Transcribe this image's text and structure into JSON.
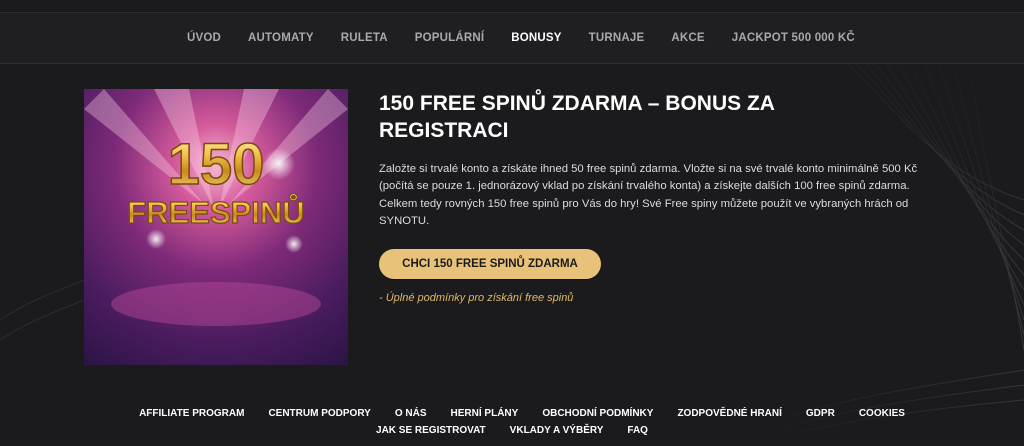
{
  "nav": {
    "items": [
      {
        "label": "ÚVOD",
        "active": false
      },
      {
        "label": "AUTOMATY",
        "active": false
      },
      {
        "label": "RULETA",
        "active": false
      },
      {
        "label": "POPULÁRNÍ",
        "active": false
      },
      {
        "label": "BONUSY",
        "active": true
      },
      {
        "label": "TURNAJE",
        "active": false
      },
      {
        "label": "AKCE",
        "active": false
      },
      {
        "label": "JACKPOT 500 000 KČ",
        "active": false
      }
    ]
  },
  "promo": {
    "image_number": "150",
    "image_word": "FREESPINŮ",
    "title": "150 FREE SPINŮ ZDARMA – BONUS ZA REGISTRACI",
    "description": "Založte si trvalé konto a získáte ihned 50 free spinů zdarma. Vložte si na své trvalé konto minimálně 500 Kč (počítá se pouze 1. jednorázový vklad po získání trvalého konta) a získejte dalších 100 free spinů zdarma. Celkem tedy rovných 150 free spinů pro Vás do hry! Své Free spiny můžete použít ve vybraných hrách od SYNOTU.",
    "cta_label": "CHCI 150 FREE SPINŮ ZDARMA",
    "terms_label": "- Úplné podmínky pro získání free spinů"
  },
  "footer": {
    "row1": [
      "AFFILIATE PROGRAM",
      "CENTRUM PODPORY",
      "O NÁS",
      "HERNÍ PLÁNY",
      "OBCHODNÍ PODMÍNKY",
      "ZODPOVĚDNÉ HRANÍ",
      "GDPR",
      "COOKIES"
    ],
    "row2": [
      "JAK SE REGISTROVAT",
      "VKLADY A VÝBĚRY",
      "FAQ"
    ]
  },
  "colors": {
    "background": "#1b1b1d",
    "accent_gold": "#e9c279",
    "link_gold": "#e0b86b",
    "nav_text": "#a9a9ad"
  }
}
